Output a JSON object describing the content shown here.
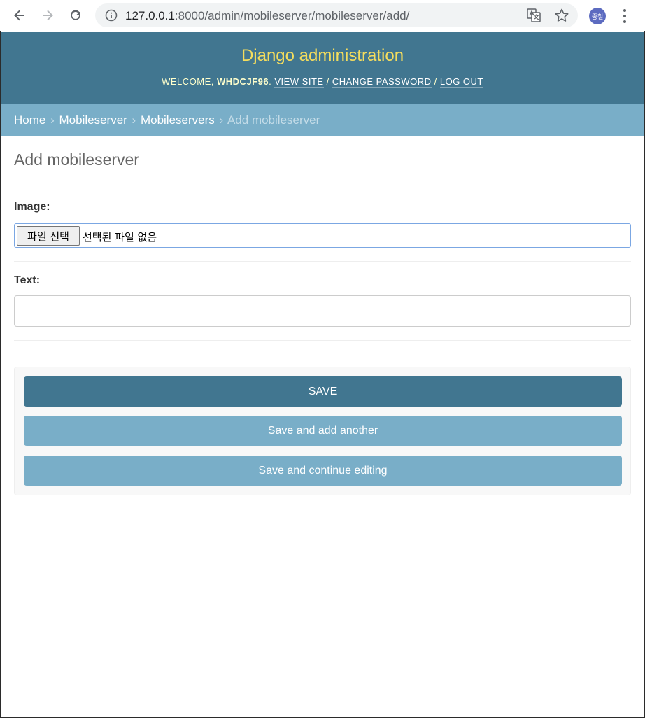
{
  "browser": {
    "url_host": "127.0.0.1",
    "url_rest": ":8000/admin/mobileserver/mobileserver/add/",
    "profile_initials": "종철",
    "icons": [
      "back-icon",
      "forward-icon",
      "reload-icon",
      "info-icon",
      "translate-icon",
      "star-icon",
      "menu-icon"
    ]
  },
  "header": {
    "site_title": "Django administration",
    "welcome_prefix": "WELCOME, ",
    "username": "WHDCJF96",
    "welcome_suffix": ". ",
    "view_site": "VIEW SITE",
    "sep1": " / ",
    "change_password": "CHANGE PASSWORD",
    "sep2": " / ",
    "log_out": "LOG OUT"
  },
  "breadcrumbs": {
    "home": "Home",
    "app": "Mobileserver",
    "model": "Mobileservers",
    "current": "Add mobileserver",
    "separator": "›"
  },
  "form": {
    "title": "Add mobileserver",
    "image_label": "Image:",
    "file_button": "파일 선택",
    "file_status": "선택된 파일 없음",
    "text_label": "Text:",
    "text_value": ""
  },
  "actions": {
    "save": "SAVE",
    "save_add_another": "Save and add another",
    "save_continue": "Save and continue editing"
  },
  "colors": {
    "header_bg": "#417690",
    "title_yellow": "#f5dd5d",
    "breadcrumb_bg": "#79aec8",
    "primary_button": "#417690",
    "secondary_button": "#79aec8"
  }
}
